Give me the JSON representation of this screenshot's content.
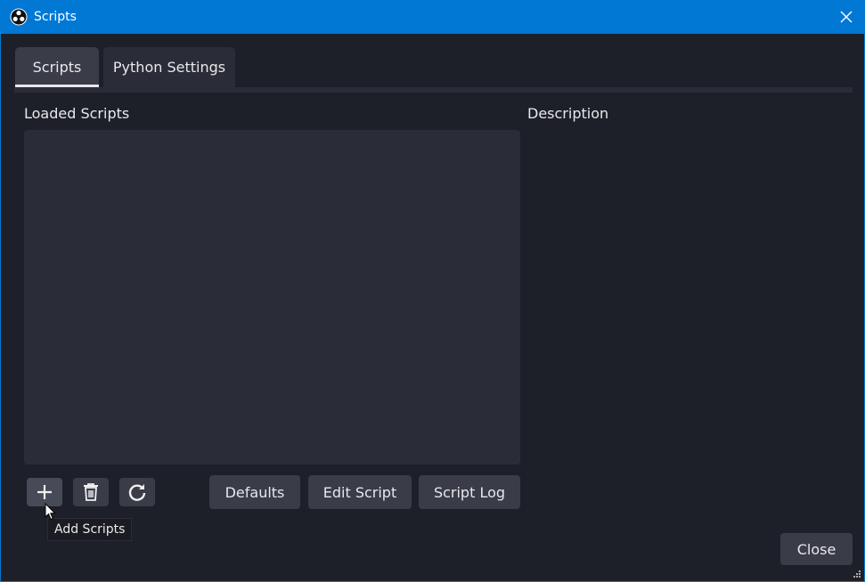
{
  "window": {
    "title": "Scripts",
    "accent_color": "#0078d4"
  },
  "tabs": [
    {
      "label": "Scripts",
      "active": true
    },
    {
      "label": "Python Settings",
      "active": false
    }
  ],
  "loaded_scripts": {
    "label": "Loaded Scripts",
    "items": []
  },
  "description": {
    "label": "Description",
    "text": ""
  },
  "toolbar": {
    "add_icon": "plus-icon",
    "remove_icon": "trash-icon",
    "reload_icon": "refresh-icon",
    "defaults_label": "Defaults",
    "edit_label": "Edit Script",
    "log_label": "Script Log"
  },
  "tooltip": {
    "text": "Add Scripts"
  },
  "footer": {
    "close_label": "Close"
  }
}
